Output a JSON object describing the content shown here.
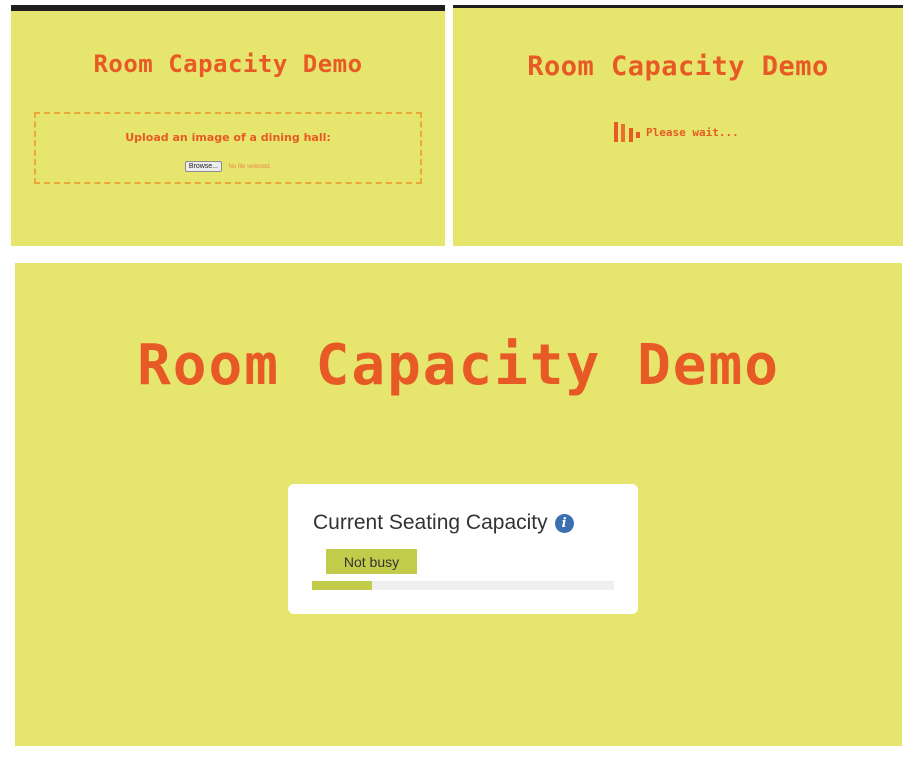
{
  "app": {
    "title": "Room Capacity Demo"
  },
  "upload": {
    "prompt": "Upload an image of a dining hall:",
    "browse_label": "Browse...",
    "file_status": "No file selected."
  },
  "loading": {
    "message": "Please wait..."
  },
  "result": {
    "card_title": "Current Seating Capacity",
    "status_label": "Not busy",
    "capacity_fraction": 0.2
  },
  "icons": {
    "info": "info-icon",
    "spinner": "loading-spinner-icon"
  },
  "colors": {
    "background": "#e6e56d",
    "title": "#e85a25",
    "accent": "#c2cc4a",
    "info": "#3a6fb0",
    "dashed_border": "#e8a83a"
  }
}
